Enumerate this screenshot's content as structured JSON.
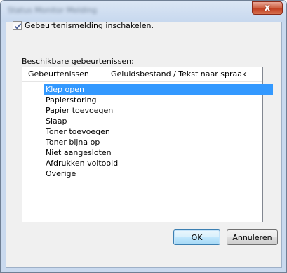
{
  "window": {
    "title": "Status Monitor Melding",
    "close_label": "x"
  },
  "enable_notification": {
    "label": "Gebeurtenismelding inschakelen.",
    "checked": true
  },
  "available_events": {
    "label": "Beschikbare gebeurtenissen:",
    "columns": [
      "Gebeurtenissen",
      "Geluidsbestand / Tekst naar spraak"
    ],
    "items": [
      "Klep open",
      "Papierstoring",
      "Papier toevoegen",
      "Slaap",
      "Toner toevoegen",
      "Toner bijna op",
      "Niet aangesloten",
      "Afdrukken voltooid",
      "Overige"
    ],
    "selected_item": "Klep open"
  },
  "buttons": {
    "ok": "OK",
    "cancel": "Annuleren"
  },
  "colors": {
    "selection": "#3399ff",
    "window_frame": "#c9d9ee",
    "close_button": "#c24022",
    "dialog_background": "#f0f0f0"
  },
  "icons": {
    "close": "close-icon",
    "checkbox": "checkmark-icon"
  }
}
